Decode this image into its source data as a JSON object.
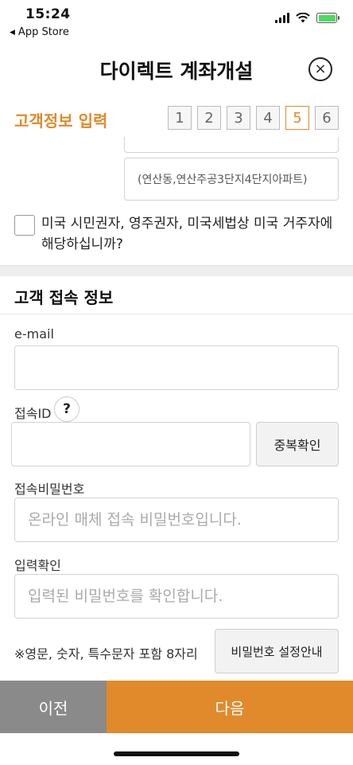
{
  "status_bar": {
    "time": "15:24",
    "back_label": "App Store",
    "back_icon": "back-triangle-icon"
  },
  "header": {
    "title": "다이렉트 계좌개설",
    "close_icon": "close-circle-icon"
  },
  "step_section": {
    "title": "고객정보 입력",
    "steps": [
      "1",
      "2",
      "3",
      "4",
      "5",
      "6"
    ],
    "active_step": "5"
  },
  "address": {
    "detail_value": "(연산동,연산주공3단지4단지아파트)"
  },
  "us_person_check": {
    "label": "미국 시민권자, 영주권자, 미국세법상 미국 거주자에 해당하십니까?",
    "checked": false
  },
  "contact_section": {
    "title": "고객 접속 정보",
    "email_label": "e-mail",
    "email_value": "",
    "id_label": "접속ID",
    "id_help": "?",
    "id_value": "",
    "duplicate_check_label": "중복확인",
    "password_label": "접속비밀번호",
    "password_placeholder": "온라인 매체 접속 비밀번호입니다.",
    "confirm_label": "입력확인",
    "confirm_placeholder": "입력된 비밀번호를 확인합니다.",
    "password_rule_note": "※영문, 숫자, 특수문자 포함 8자리",
    "password_guide_label": "비밀번호 설정안내"
  },
  "footer": {
    "prev_label": "이전",
    "next_label": "다음"
  },
  "colors": {
    "accent": "#e08a2c",
    "prev_button": "#8a8a8a",
    "battery": "#4cd964"
  }
}
